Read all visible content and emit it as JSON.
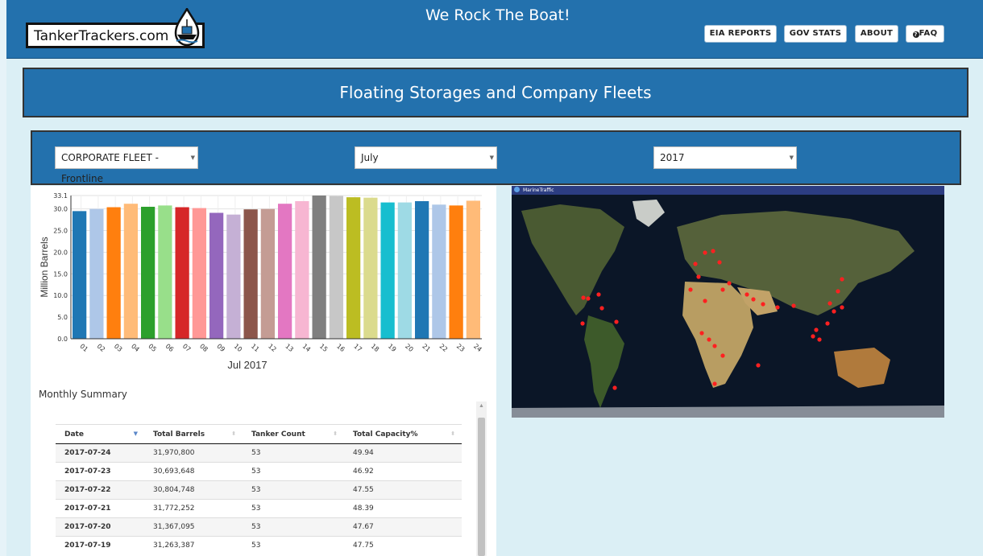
{
  "header": {
    "logo_text": "TankerTrackers.com",
    "tagline": "We Rock The Boat!",
    "nav": [
      {
        "label": "EIA REPORTS"
      },
      {
        "label": "GOV STATS"
      },
      {
        "label": "ABOUT"
      },
      {
        "label": "FAQ",
        "icon": "question-circle-icon"
      }
    ]
  },
  "banner": {
    "title": "Floating Storages and Company Fleets"
  },
  "filters": {
    "fleet": "CORPORATE FLEET - Frontline",
    "month": "July",
    "year": "2017"
  },
  "chart_data": {
    "type": "bar",
    "categories": [
      "01",
      "02",
      "03",
      "04",
      "05",
      "06",
      "07",
      "08",
      "09",
      "10",
      "11",
      "12",
      "13",
      "14",
      "15",
      "16",
      "17",
      "18",
      "19",
      "20",
      "21",
      "22",
      "23",
      "24"
    ],
    "values": [
      29.5,
      30.0,
      30.4,
      31.2,
      30.5,
      30.8,
      30.4,
      30.2,
      29.1,
      28.7,
      29.9,
      30.0,
      31.2,
      31.8,
      33.1,
      33.0,
      32.7,
      32.6,
      31.5,
      31.5,
      31.8,
      31.0,
      30.8,
      31.9
    ],
    "colors": [
      "#1f77b4",
      "#aec7e8",
      "#ff7f0e",
      "#ffbb78",
      "#2ca02c",
      "#98df8a",
      "#d62728",
      "#ff9896",
      "#9467bd",
      "#c5b0d5",
      "#8c564b",
      "#c49c94",
      "#e377c2",
      "#f7b6d2",
      "#7f7f7f",
      "#c7c7c7",
      "#bcbd22",
      "#dbdb8d",
      "#17becf",
      "#9edae5",
      "#1f77b4",
      "#aec7e8",
      "#ff7f0e",
      "#ffbb78"
    ],
    "title": "",
    "xlabel": "Jul 2017",
    "ylabel": "Million Barrels",
    "yticks": [
      "0.0",
      "5.0",
      "10.0",
      "15.0",
      "20.0",
      "25.0",
      "30.0",
      "33.1"
    ],
    "ylim": [
      0,
      33.1
    ],
    "grid": true
  },
  "summary": {
    "title": "Monthly Summary",
    "columns": [
      "Date",
      "Total Barrels",
      "Tanker Count",
      "Total Capacity%"
    ],
    "rows": [
      [
        "2017-07-24",
        "31,970,800",
        "53",
        "49.94"
      ],
      [
        "2017-07-23",
        "30,693,648",
        "53",
        "46.92"
      ],
      [
        "2017-07-22",
        "30,804,748",
        "53",
        "47.55"
      ],
      [
        "2017-07-21",
        "31,772,252",
        "53",
        "48.39"
      ],
      [
        "2017-07-20",
        "31,367,095",
        "53",
        "47.67"
      ],
      [
        "2017-07-19",
        "31,263,387",
        "53",
        "47.75"
      ]
    ]
  },
  "map": {
    "provider": "MarineTraffic",
    "marker_color": "#ff2020"
  }
}
